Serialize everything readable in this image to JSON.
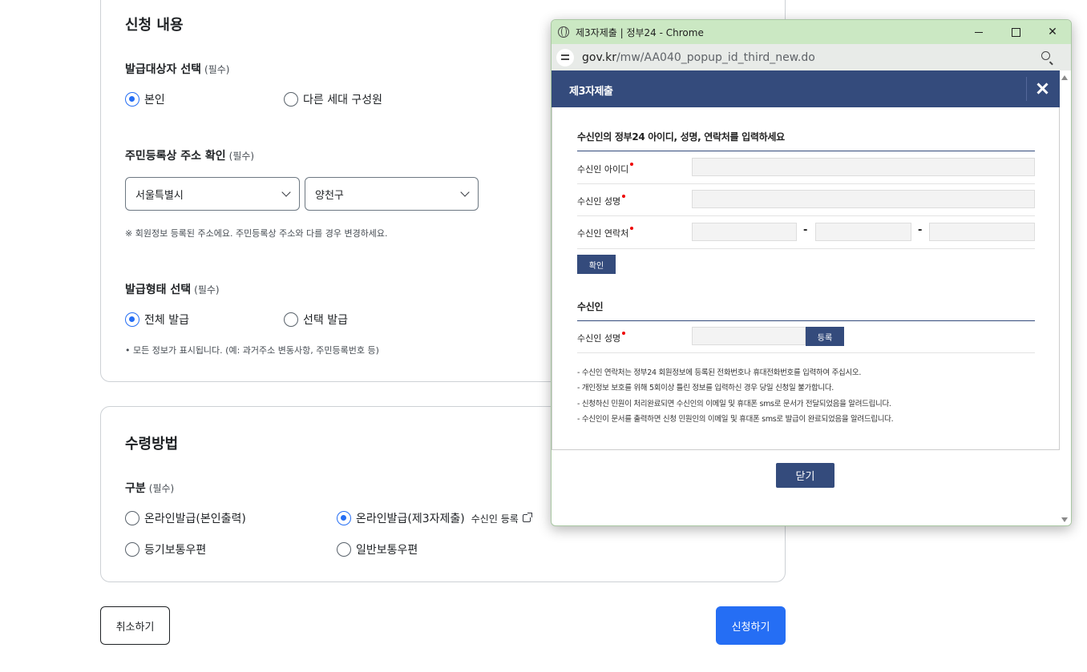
{
  "form": {
    "apply_section_title": "신청 내용",
    "target": {
      "label": "발급대상자 선택",
      "required": "(필수)",
      "options": [
        "본인",
        "다른 세대 구성원"
      ],
      "selected": "본인"
    },
    "address": {
      "label": "주민등록상 주소 확인",
      "required": "(필수)",
      "city": "서울특별시",
      "district": "양천구",
      "help": "※ 회원정보 등록된 주소에요. 주민등록상 주소와 다를 경우 변경하세요."
    },
    "issue_type": {
      "label": "발급형태 선택",
      "required": "(필수)",
      "options": [
        "전체 발급",
        "선택 발급"
      ],
      "selected": "전체 발급",
      "help": "• 모든 정보가 표시됩니다. (예: 과거주소 변동사항, 주민등록번호 등)"
    },
    "receive_section_title": "수령방법",
    "receive": {
      "label": "구분",
      "required": "(필수)",
      "options": [
        "온라인발급(본인출력)",
        "온라인발급(제3자제출)",
        "등기보통우편",
        "일반보통우편"
      ],
      "selected": "온라인발급(제3자제출)",
      "register_link": "수신인 등록"
    },
    "cancel_label": "취소하기",
    "submit_label": "신청하기"
  },
  "popup": {
    "window_title": "제3자제출 | 정부24 - Chrome",
    "window_close": "✕",
    "url_host": "gov.kr",
    "url_path": "/mw/AA040_popup_id_third_new.do",
    "modal_title": "제3자제출",
    "section1_title": "수신인의 정부24 아이디, 성명, 연락처를 입력하세요",
    "label_id": "수신인 아이디",
    "label_name": "수신인 성명",
    "label_phone": "수신인 연락처",
    "dash": "-",
    "confirm_label": "확인",
    "section2_title": "수신인",
    "label_recipient_name": "수신인 성명",
    "register_label": "등록",
    "notices": [
      "- 수신인 연락처는 정부24 회원정보에 등록된 전화번호나 휴대전화번호를 입력하여 주십시오.",
      "- 개인정보 보호를 위해 5회이상 틀린 정보를 입력하신 경우 당일 신청일 불가합니다.",
      "- 신청하신 민원이 처리완료되면 수신인의 이메일 및 휴대폰 sms로 문서가 전달되었음을 알려드립니다.",
      "- 수신인이 문서를 출력하면 신청 민원인의 이메일 및 휴대폰 sms로 발급이 완료되었음을 알려드립니다."
    ],
    "close_label": "닫기"
  },
  "colors": {
    "primary": "#256ef4",
    "modal_header": "#344b7c",
    "titlebar": "#cbe8c3",
    "required_dot": "#ee0000"
  }
}
